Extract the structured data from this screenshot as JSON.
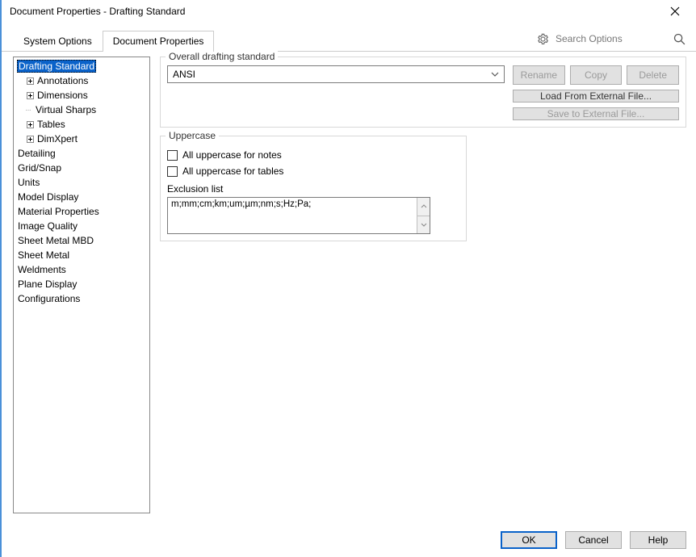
{
  "window": {
    "title": "Document Properties - Drafting Standard"
  },
  "tabs": {
    "system_options": "System Options",
    "document_properties": "Document Properties"
  },
  "search": {
    "placeholder": "Search Options"
  },
  "tree": {
    "drafting_standard": "Drafting Standard",
    "annotations": "Annotations",
    "dimensions": "Dimensions",
    "virtual_sharps": "Virtual Sharps",
    "tables": "Tables",
    "dimxpert": "DimXpert",
    "detailing": "Detailing",
    "grid_snap": "Grid/Snap",
    "units": "Units",
    "model_display": "Model Display",
    "material_properties": "Material Properties",
    "image_quality": "Image Quality",
    "sheet_metal_mbd": "Sheet Metal MBD",
    "sheet_metal": "Sheet Metal",
    "weldments": "Weldments",
    "plane_display": "Plane Display",
    "configurations": "Configurations"
  },
  "main": {
    "overall_label": "Overall drafting standard",
    "standard_value": "ANSI",
    "rename": "Rename",
    "copy": "Copy",
    "delete": "Delete",
    "load_external": "Load From External File...",
    "save_external": "Save to External File...",
    "uppercase_title": "Uppercase",
    "uppercase_notes": "All uppercase for notes",
    "uppercase_tables": "All uppercase for tables",
    "exclusion_label": "Exclusion list",
    "exclusion_value": "m;mm;cm;km;um;µm;nm;s;Hz;Pa;"
  },
  "footer": {
    "ok": "OK",
    "cancel": "Cancel",
    "help": "Help"
  }
}
